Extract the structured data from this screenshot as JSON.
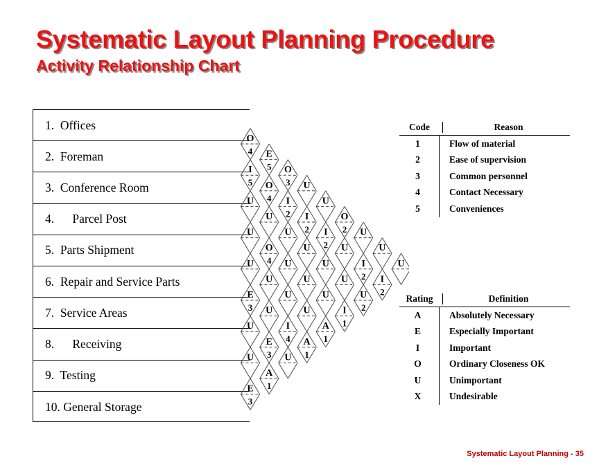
{
  "title": {
    "main": "Systematic Layout Planning Procedure",
    "sub": "Activity Relationship Chart",
    "accent_color": "#ee1111",
    "shadow_color": "#8d8d8d"
  },
  "footer": {
    "text": "Systematic Layout Planning - 35",
    "color": "#c00000"
  },
  "activities": [
    {
      "number": "1.",
      "name": "Offices",
      "label": "1.  Offices"
    },
    {
      "number": "2.",
      "name": "Foreman",
      "label": "2.  Foreman"
    },
    {
      "number": "3.",
      "name": "Conference Room",
      "label": "3.  Conference Room"
    },
    {
      "number": "4.",
      "name": "Parcel Post",
      "label": "4.      Parcel Post"
    },
    {
      "number": "5.",
      "name": "Parts Shipment",
      "label": "5.  Parts Shipment"
    },
    {
      "number": "6.",
      "name": "Repair and Service Parts",
      "label": "6.  Repair and Service Parts"
    },
    {
      "number": "7.",
      "name": "Service Areas",
      "label": "7.  Service Areas"
    },
    {
      "number": "8.",
      "name": "Receiving",
      "label": "8.      Receiving"
    },
    {
      "number": "9.",
      "name": "Testing",
      "label": "9.  Testing"
    },
    {
      "number": "10.",
      "name": "General Storage",
      "label": "10. General Storage"
    }
  ],
  "reason_legend": {
    "headers": [
      "Code",
      "Reason"
    ],
    "rows": [
      {
        "code": "1",
        "reason": "Flow of material"
      },
      {
        "code": "2",
        "reason": "Ease of supervision"
      },
      {
        "code": "3",
        "reason": "Common personnel"
      },
      {
        "code": "4",
        "reason": "Contact Necessary"
      },
      {
        "code": "5",
        "reason": "Conveniences"
      }
    ]
  },
  "rating_legend": {
    "headers": [
      "Rating",
      "Definition"
    ],
    "rows": [
      {
        "rating": "A",
        "definition": "Absolutely Necessary"
      },
      {
        "rating": "E",
        "definition": "Especially Important"
      },
      {
        "rating": "I",
        "definition": "Important"
      },
      {
        "rating": "O",
        "definition": "Ordinary Closeness OK"
      },
      {
        "rating": "U",
        "definition": "Unimportant"
      },
      {
        "rating": "X",
        "definition": "Undesirable"
      }
    ]
  },
  "chart_data": {
    "type": "table",
    "title": "Activity Relationship Chart",
    "description": "Triangular SLP relationship matrix: each diamond holds a closeness rating (A/E/I/O/U/X) above and a reason code (1-5) below.",
    "activity_count": 10,
    "rating_codes": [
      "A",
      "E",
      "I",
      "O",
      "U",
      "X"
    ],
    "reason_codes": [
      "1",
      "2",
      "3",
      "4",
      "5"
    ],
    "columns": [
      {
        "from": 1,
        "cells": [
          {
            "to": 2,
            "rating": "O",
            "reason": "4"
          },
          {
            "to": 3,
            "rating": "I",
            "reason": "5"
          },
          {
            "to": 4,
            "rating": "U",
            "reason": ""
          },
          {
            "to": 5,
            "rating": "U",
            "reason": ""
          },
          {
            "to": 6,
            "rating": "U",
            "reason": ""
          },
          {
            "to": 7,
            "rating": "E",
            "reason": "3"
          },
          {
            "to": 8,
            "rating": "U",
            "reason": ""
          },
          {
            "to": 9,
            "rating": "U",
            "reason": ""
          },
          {
            "to": 10,
            "rating": "E",
            "reason": "3"
          }
        ]
      },
      {
        "from": 2,
        "cells": [
          {
            "to": 3,
            "rating": "E",
            "reason": "5"
          },
          {
            "to": 4,
            "rating": "O",
            "reason": "4"
          },
          {
            "to": 5,
            "rating": "U",
            "reason": ""
          },
          {
            "to": 6,
            "rating": "O",
            "reason": "4"
          },
          {
            "to": 7,
            "rating": "U",
            "reason": ""
          },
          {
            "to": 8,
            "rating": "U",
            "reason": ""
          },
          {
            "to": 9,
            "rating": "E",
            "reason": "3"
          },
          {
            "to": 10,
            "rating": "A",
            "reason": "1"
          }
        ]
      },
      {
        "from": 3,
        "cells": [
          {
            "to": 4,
            "rating": "O",
            "reason": "3"
          },
          {
            "to": 5,
            "rating": "I",
            "reason": "2"
          },
          {
            "to": 6,
            "rating": "U",
            "reason": ""
          },
          {
            "to": 7,
            "rating": "U",
            "reason": ""
          },
          {
            "to": 8,
            "rating": "U",
            "reason": ""
          },
          {
            "to": 9,
            "rating": "I",
            "reason": "4"
          },
          {
            "to": 10,
            "rating": "U",
            "reason": ""
          }
        ]
      },
      {
        "from": 4,
        "cells": [
          {
            "to": 5,
            "rating": "U",
            "reason": ""
          },
          {
            "to": 6,
            "rating": "I",
            "reason": "2"
          },
          {
            "to": 7,
            "rating": "U",
            "reason": ""
          },
          {
            "to": 8,
            "rating": "U",
            "reason": ""
          },
          {
            "to": 9,
            "rating": "U",
            "reason": ""
          },
          {
            "to": 10,
            "rating": "A",
            "reason": "1"
          }
        ]
      },
      {
        "from": 5,
        "cells": [
          {
            "to": 6,
            "rating": "U",
            "reason": ""
          },
          {
            "to": 7,
            "rating": "I",
            "reason": "2"
          },
          {
            "to": 8,
            "rating": "U",
            "reason": ""
          },
          {
            "to": 9,
            "rating": "U",
            "reason": ""
          },
          {
            "to": 10,
            "rating": "A",
            "reason": "1"
          }
        ]
      },
      {
        "from": 6,
        "cells": [
          {
            "to": 7,
            "rating": "O",
            "reason": "2"
          },
          {
            "to": 8,
            "rating": "U",
            "reason": ""
          },
          {
            "to": 9,
            "rating": "U",
            "reason": ""
          },
          {
            "to": 10,
            "rating": "I",
            "reason": "1"
          }
        ]
      },
      {
        "from": 7,
        "cells": [
          {
            "to": 8,
            "rating": "U",
            "reason": ""
          },
          {
            "to": 9,
            "rating": "I",
            "reason": "2"
          },
          {
            "to": 10,
            "rating": "U",
            "reason": "2"
          }
        ]
      },
      {
        "from": 8,
        "cells": [
          {
            "to": 9,
            "rating": "U",
            "reason": ""
          },
          {
            "to": 10,
            "rating": "I",
            "reason": "2"
          }
        ]
      },
      {
        "from": 9,
        "cells": [
          {
            "to": 10,
            "rating": "U",
            "reason": ""
          }
        ]
      }
    ]
  }
}
